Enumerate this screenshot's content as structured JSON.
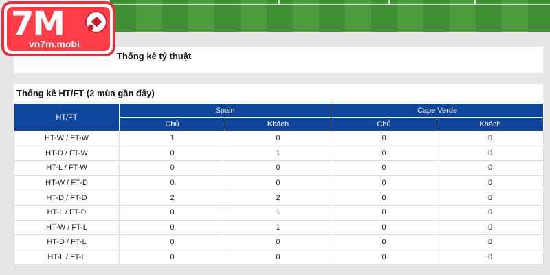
{
  "logo": {
    "mark": "7M",
    "text": "vn7m.mobi"
  },
  "top_panel": {
    "title": "Thống kê tỷ thuật"
  },
  "stats": {
    "title": "Thống kê HT/FT (2 mùa gần đây)",
    "row_header": "HT/FT",
    "teams": [
      "Spain",
      "Cape Verde"
    ],
    "subheaders": [
      "Chủ",
      "Khách",
      "Chủ",
      "Khách"
    ],
    "rows": [
      {
        "label": "HT-W / FT-W",
        "values": [
          "1",
          "0",
          "0",
          "0"
        ]
      },
      {
        "label": "HT-D / FT-W",
        "values": [
          "0",
          "1",
          "0",
          "0"
        ]
      },
      {
        "label": "HT-L / FT-W",
        "values": [
          "0",
          "0",
          "0",
          "0"
        ]
      },
      {
        "label": "HT-W / FT-D",
        "values": [
          "0",
          "0",
          "0",
          "0"
        ]
      },
      {
        "label": "HT-D / FT-D",
        "values": [
          "2",
          "2",
          "0",
          "0"
        ]
      },
      {
        "label": "HT-L / FT-D",
        "values": [
          "0",
          "1",
          "0",
          "0"
        ]
      },
      {
        "label": "HT-W / FT-L",
        "values": [
          "0",
          "1",
          "0",
          "0"
        ]
      },
      {
        "label": "HT-D / FT-L",
        "values": [
          "0",
          "0",
          "0",
          "0"
        ]
      },
      {
        "label": "HT-L / FT-L",
        "values": [
          "0",
          "0",
          "0",
          "0"
        ]
      }
    ]
  },
  "colors": {
    "header_blue": "#10459e",
    "logo_red": "#ff3d48",
    "pitch_green": "#4a9c3d"
  }
}
